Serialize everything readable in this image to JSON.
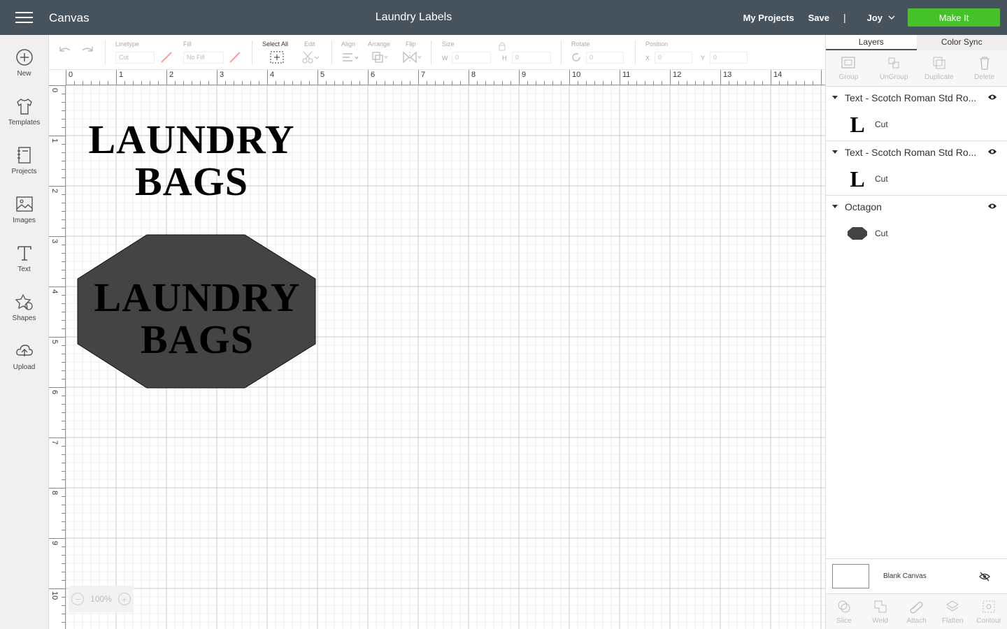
{
  "header": {
    "app_title": "Canvas",
    "doc_title": "Laundry Labels",
    "my_projects": "My Projects",
    "save": "Save",
    "separator": "|",
    "user": "Joy",
    "make_it": "Make It"
  },
  "sidebar": {
    "items": [
      {
        "label": "New",
        "icon": "plus-circle-icon"
      },
      {
        "label": "Templates",
        "icon": "tshirt-icon"
      },
      {
        "label": "Projects",
        "icon": "notebook-icon"
      },
      {
        "label": "Images",
        "icon": "image-icon"
      },
      {
        "label": "Text",
        "icon": "text-t-icon"
      },
      {
        "label": "Shapes",
        "icon": "shapes-icon"
      },
      {
        "label": "Upload",
        "icon": "cloud-upload-icon"
      }
    ]
  },
  "toolbar": {
    "linetype_label": "Linetype",
    "linetype_value": "Cut",
    "fill_label": "Fill",
    "fill_value": "No Fill",
    "select_all": "Select All",
    "edit": "Edit",
    "align": "Align",
    "arrange": "Arrange",
    "flip": "Flip",
    "size": "Size",
    "w_label": "W",
    "w_value": "0",
    "h_label": "H",
    "h_value": "0",
    "rotate": "Rotate",
    "rotate_value": "0",
    "position": "Position",
    "x_label": "X",
    "x_value": "0",
    "y_label": "Y",
    "y_value": "0"
  },
  "ruler": {
    "top": [
      "0",
      "1",
      "2",
      "3",
      "4",
      "5",
      "6",
      "7",
      "8",
      "9",
      "10",
      "11",
      "12",
      "13",
      "14"
    ],
    "left": [
      "0",
      "1",
      "2",
      "3",
      "4",
      "5",
      "6",
      "7",
      "8",
      "9",
      "10"
    ]
  },
  "canvas": {
    "text1_line1": "LAUNDRY",
    "text1_line2": "BAGS",
    "text2_line1": "LAUNDRY",
    "text2_line2": "BAGS",
    "octagon_color": "#444444",
    "zoom": "100%"
  },
  "panel": {
    "tab_layers": "Layers",
    "tab_color_sync": "Color Sync",
    "tools": [
      {
        "label": "Group",
        "icon": "group-icon"
      },
      {
        "label": "UnGroup",
        "icon": "ungroup-icon"
      },
      {
        "label": "Duplicate",
        "icon": "duplicate-icon"
      },
      {
        "label": "Delete",
        "icon": "trash-icon"
      }
    ],
    "layers": [
      {
        "title": "Text - Scotch Roman Std Ro...",
        "thumb": "L",
        "op": "Cut"
      },
      {
        "title": "Text - Scotch Roman Std Ro...",
        "thumb": "L",
        "op": "Cut"
      },
      {
        "title": "Octagon",
        "thumb": "",
        "op": "Cut"
      }
    ],
    "blank_canvas": "Blank Canvas",
    "bottom_tools": [
      {
        "label": "Slice",
        "icon": "slice-icon"
      },
      {
        "label": "Weld",
        "icon": "weld-icon"
      },
      {
        "label": "Attach",
        "icon": "attach-icon"
      },
      {
        "label": "Flatten",
        "icon": "flatten-icon"
      },
      {
        "label": "Contour",
        "icon": "contour-icon"
      }
    ]
  },
  "colors": {
    "header_bg": "#46525c",
    "make_it_green": "#45c12a"
  }
}
